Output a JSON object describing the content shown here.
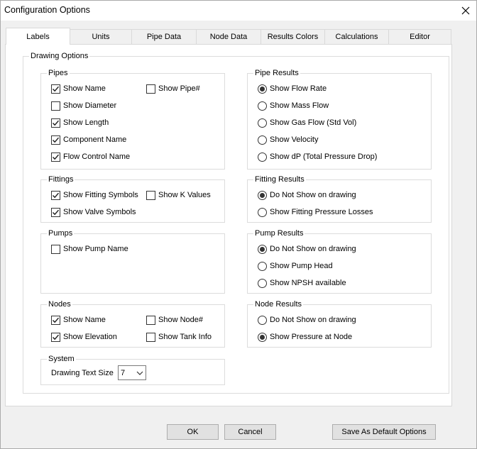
{
  "window": {
    "title": "Configuration Options",
    "close_glyph": "✕"
  },
  "tabs": [
    {
      "label": "Labels",
      "active": true
    },
    {
      "label": "Units"
    },
    {
      "label": "Pipe Data"
    },
    {
      "label": "Node Data"
    },
    {
      "label": "Results Colors"
    },
    {
      "label": "Calculations"
    },
    {
      "label": "Editor"
    }
  ],
  "drawing_options": {
    "title": "Drawing Options",
    "pipes": {
      "title": "Pipes",
      "show_name": {
        "label": "Show Name",
        "checked": true
      },
      "show_pipe_num": {
        "label": "Show Pipe#",
        "checked": false
      },
      "show_diameter": {
        "label": "Show Diameter",
        "checked": false
      },
      "show_length": {
        "label": "Show Length",
        "checked": true
      },
      "component_name": {
        "label": "Component Name",
        "checked": true
      },
      "flow_control_name": {
        "label": "Flow Control Name",
        "checked": true
      }
    },
    "fittings": {
      "title": "Fittings",
      "show_fitting_symbols": {
        "label": "Show Fitting Symbols",
        "checked": true
      },
      "show_k_values": {
        "label": "Show K Values",
        "checked": false
      },
      "show_valve_symbols": {
        "label": "Show Valve Symbols",
        "checked": true
      }
    },
    "pumps": {
      "title": "Pumps",
      "show_pump_name": {
        "label": "Show Pump Name",
        "checked": false
      }
    },
    "nodes": {
      "title": "Nodes",
      "show_name": {
        "label": "Show Name",
        "checked": true
      },
      "show_node_num": {
        "label": "Show Node#",
        "checked": false
      },
      "show_elevation": {
        "label": "Show Elevation",
        "checked": true
      },
      "show_tank_info": {
        "label": "Show Tank Info",
        "checked": false
      }
    },
    "system": {
      "title": "System",
      "text_size_label": "Drawing Text Size",
      "text_size_value": "7"
    },
    "pipe_results": {
      "title": "Pipe Results",
      "options": [
        {
          "label": "Show Flow Rate",
          "selected": true
        },
        {
          "label": "Show Mass Flow",
          "selected": false
        },
        {
          "label": "Show Gas Flow (Std Vol)",
          "selected": false
        },
        {
          "label": "Show Velocity",
          "selected": false
        },
        {
          "label": "Show dP (Total Pressure Drop)",
          "selected": false
        }
      ]
    },
    "fitting_results": {
      "title": "Fitting Results",
      "options": [
        {
          "label": "Do Not Show on drawing",
          "selected": true
        },
        {
          "label": "Show Fitting Pressure Losses",
          "selected": false
        }
      ]
    },
    "pump_results": {
      "title": "Pump Results",
      "options": [
        {
          "label": "Do Not Show on drawing",
          "selected": true
        },
        {
          "label": "Show Pump Head",
          "selected": false
        },
        {
          "label": "Show NPSH available",
          "selected": false
        }
      ]
    },
    "node_results": {
      "title": "Node Results",
      "options": [
        {
          "label": "Do Not Show on drawing",
          "selected": false
        },
        {
          "label": "Show Pressure at Node",
          "selected": true
        }
      ]
    }
  },
  "buttons": {
    "ok": "OK",
    "cancel": "Cancel",
    "save_default": "Save As Default Options"
  }
}
